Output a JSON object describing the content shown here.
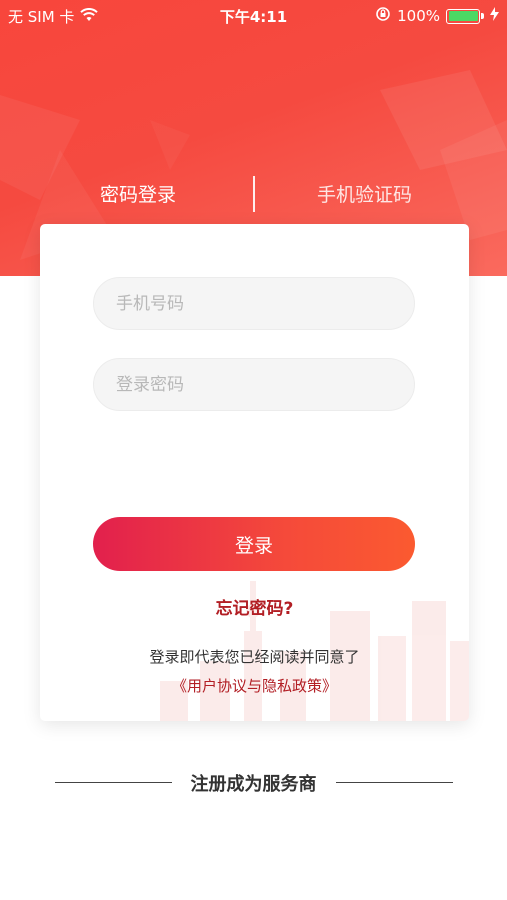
{
  "status_bar": {
    "carrier": "无 SIM 卡",
    "time": "下午4:11",
    "battery_percent": "100%",
    "battery_level": 1.0,
    "icons": [
      "wifi-icon",
      "rotation-lock-icon",
      "battery-icon",
      "charging-icon"
    ]
  },
  "tabs": {
    "password_login": "密码登录",
    "sms_login": "手机验证码",
    "active": "password_login"
  },
  "form": {
    "phone_placeholder": "手机号码",
    "phone_value": "",
    "password_placeholder": "登录密码",
    "password_value": "",
    "login_label": "登录",
    "forgot_label": "忘记密码?",
    "agreement_text": "登录即代表您已经阅读并同意了",
    "agreement_link": "《用户协议与隐私政策》"
  },
  "register": {
    "label": "注册成为服务商"
  },
  "colors": {
    "header_red": "#f5463c",
    "button_start": "#e2204d",
    "button_end": "#fb5a30",
    "link_red": "#b21e24",
    "battery_green": "#4cd964"
  }
}
